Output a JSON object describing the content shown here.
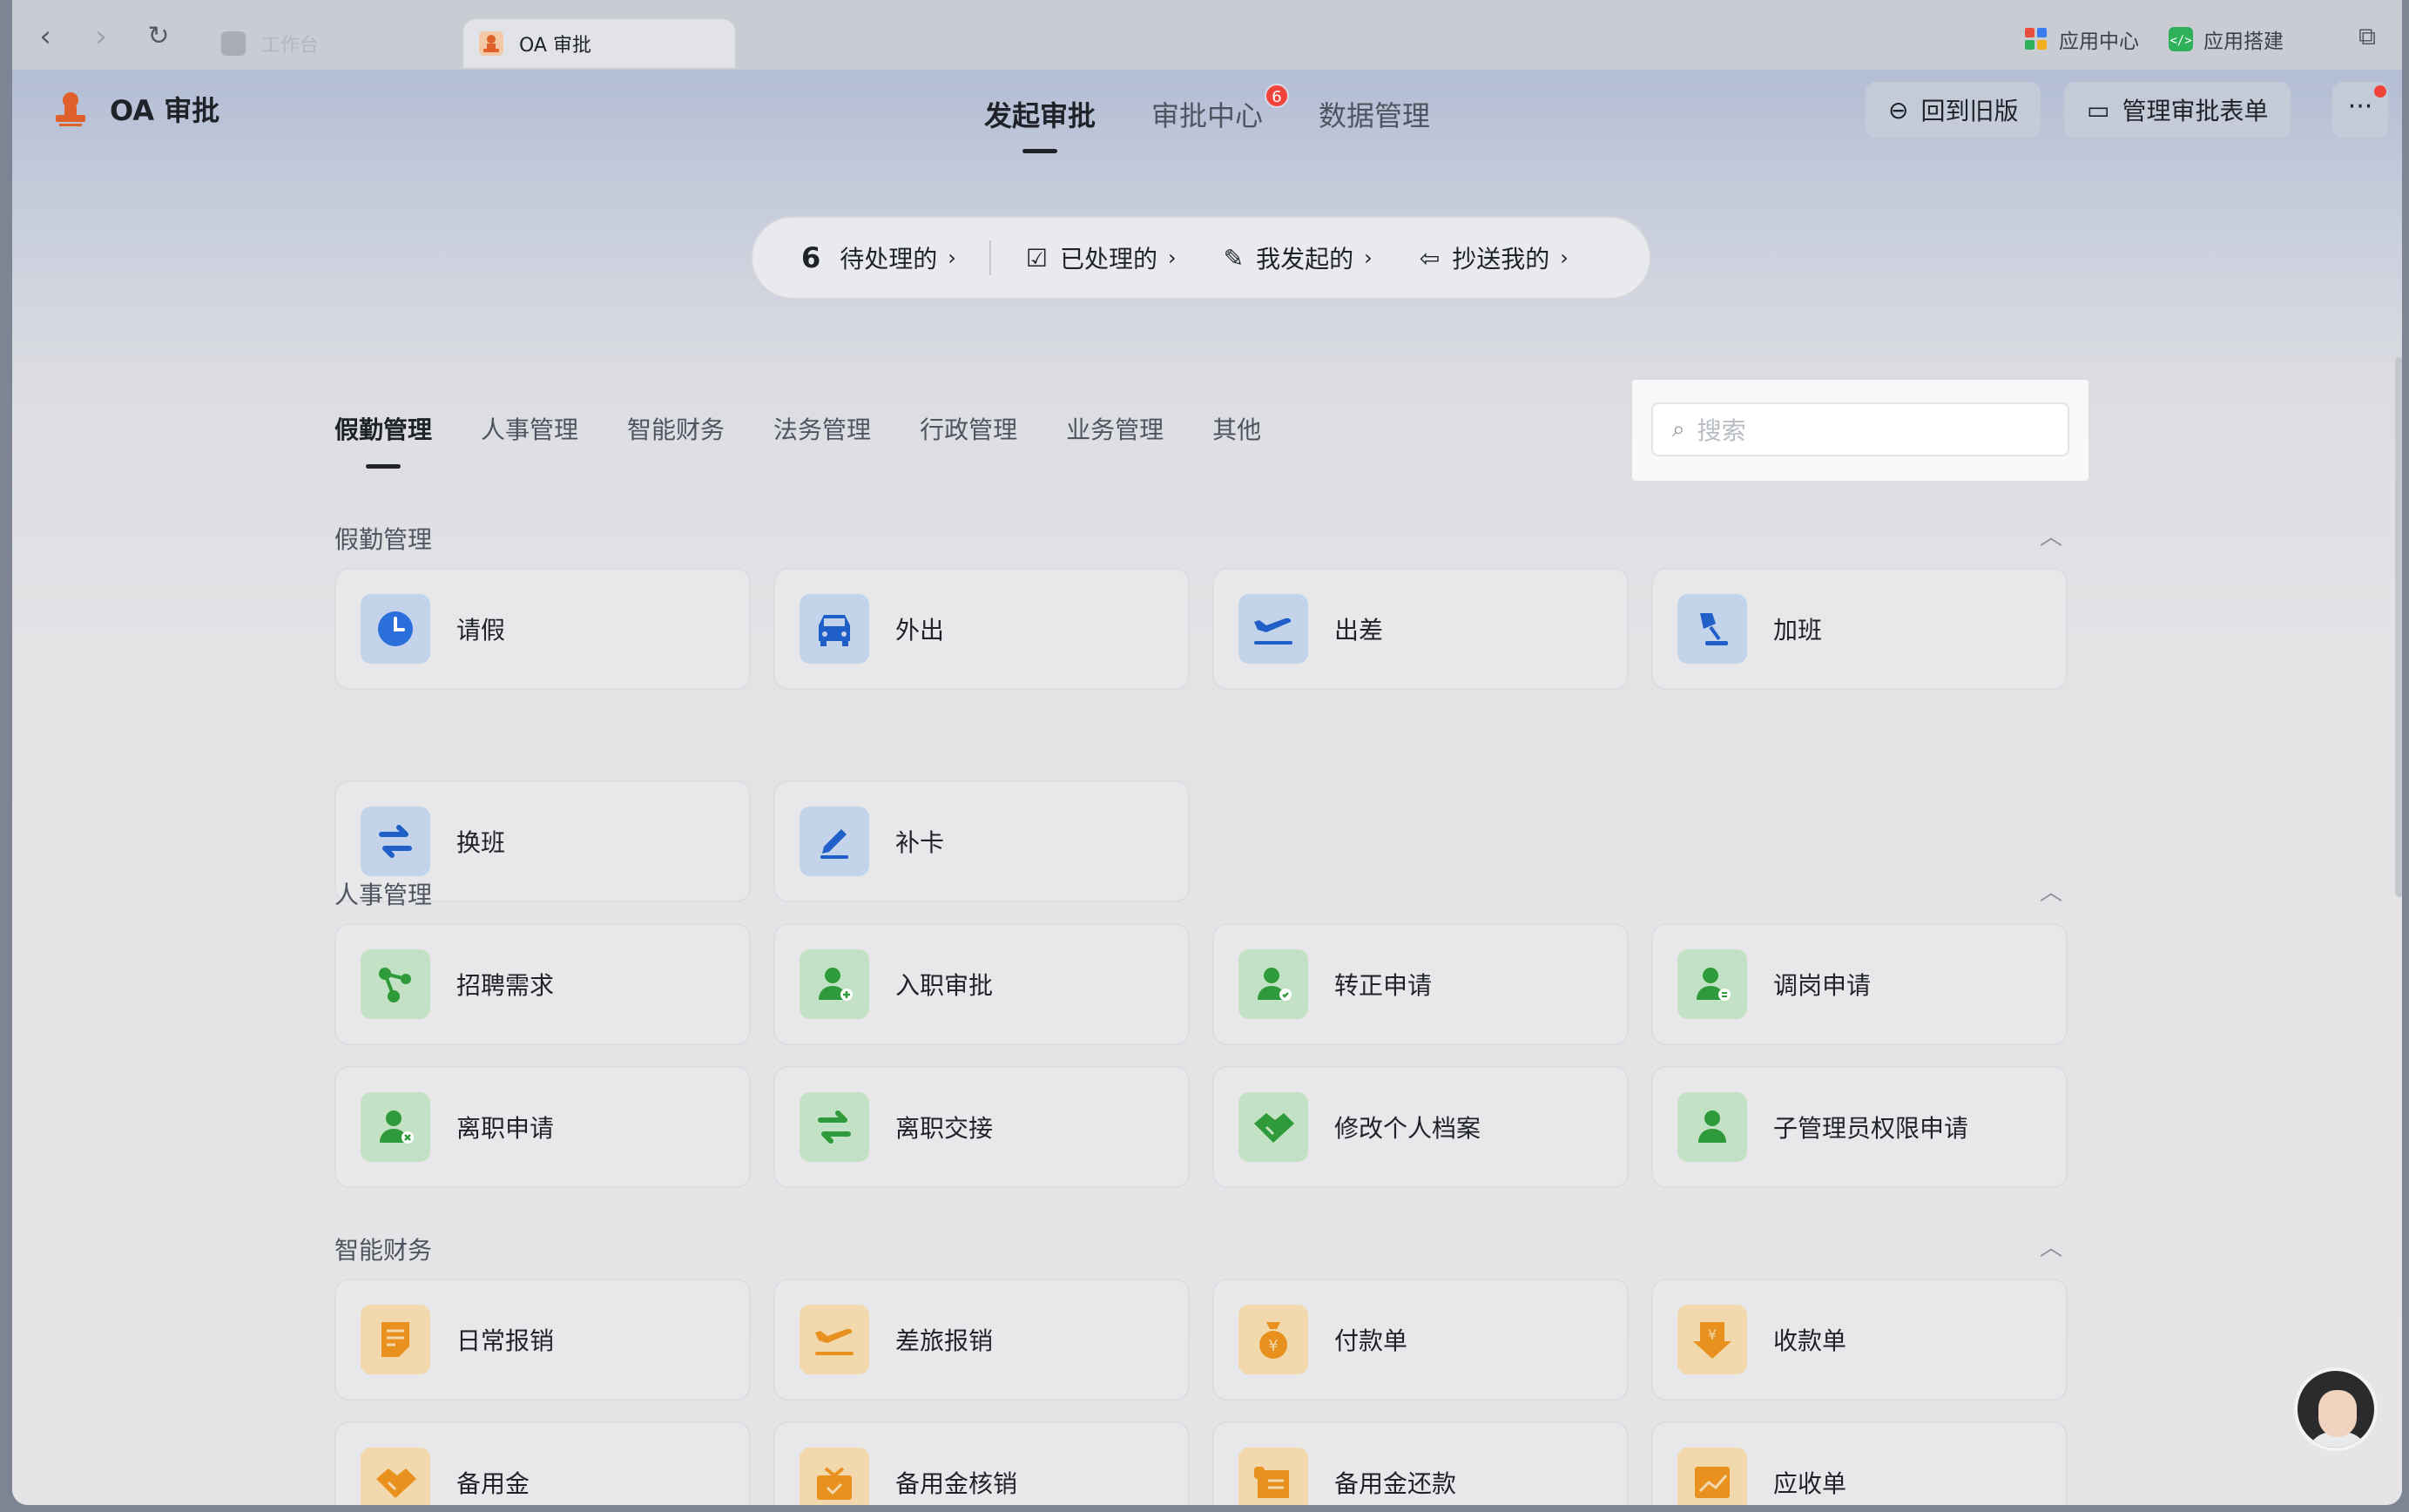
{
  "browser": {
    "tabs": [
      {
        "label": "工作台"
      },
      {
        "label": "OA 审批"
      }
    ],
    "right_items": [
      {
        "label": "应用中心"
      },
      {
        "label": "应用搭建"
      }
    ]
  },
  "app": {
    "title": "OA 审批",
    "top_tabs": [
      {
        "label": "发起审批",
        "active": true
      },
      {
        "label": "审批中心",
        "badge": "6"
      },
      {
        "label": "数据管理"
      }
    ],
    "buttons": {
      "back_old": "回到旧版",
      "manage_forms": "管理审批表单",
      "more": "···"
    }
  },
  "status": {
    "pending_count": "6",
    "pending_label": "待处理的",
    "processed_label": "已处理的",
    "initiated_label": "我发起的",
    "cc_label": "抄送我的"
  },
  "category_tabs": [
    "假勤管理",
    "人事管理",
    "智能财务",
    "法务管理",
    "行政管理",
    "业务管理",
    "其他"
  ],
  "search": {
    "placeholder": "搜索"
  },
  "sections": [
    {
      "title": "假勤管理",
      "items": [
        {
          "label": "请假",
          "icon": "clock-icon"
        },
        {
          "label": "外出",
          "icon": "car-icon"
        },
        {
          "label": "出差",
          "icon": "plane-icon"
        },
        {
          "label": "加班",
          "icon": "desk-lamp-icon"
        },
        {
          "label": "换班",
          "icon": "swap-icon"
        },
        {
          "label": "补卡",
          "icon": "pen-icon"
        }
      ]
    },
    {
      "title": "人事管理",
      "items": [
        {
          "label": "招聘需求",
          "icon": "network-icon"
        },
        {
          "label": "入职审批",
          "icon": "user-add-icon"
        },
        {
          "label": "转正申请",
          "icon": "user-check-icon"
        },
        {
          "label": "调岗申请",
          "icon": "user-transfer-icon"
        },
        {
          "label": "离职申请",
          "icon": "user-remove-icon"
        },
        {
          "label": "离职交接",
          "icon": "swap-icon"
        },
        {
          "label": "修改个人档案",
          "icon": "handshake-icon"
        },
        {
          "label": "子管理员权限申请",
          "icon": "user-icon"
        }
      ]
    },
    {
      "title": "智能财务",
      "items": [
        {
          "label": "日常报销",
          "icon": "document-icon"
        },
        {
          "label": "差旅报销",
          "icon": "plane-icon"
        },
        {
          "label": "付款单",
          "icon": "money-bag-icon"
        },
        {
          "label": "收款单",
          "icon": "receive-money-icon"
        },
        {
          "label": "备用金",
          "icon": "handshake-icon"
        },
        {
          "label": "备用金核销",
          "icon": "basket-check-icon"
        },
        {
          "label": "备用金还款",
          "icon": "receipt-icon"
        },
        {
          "label": "应收单",
          "icon": "chart-up-icon"
        }
      ]
    }
  ],
  "colors": {
    "blue_icon": "#1f5fc7",
    "green_icon": "#2f9a3a",
    "orange_icon": "#e08a1e",
    "badge_red": "#f0443a"
  }
}
